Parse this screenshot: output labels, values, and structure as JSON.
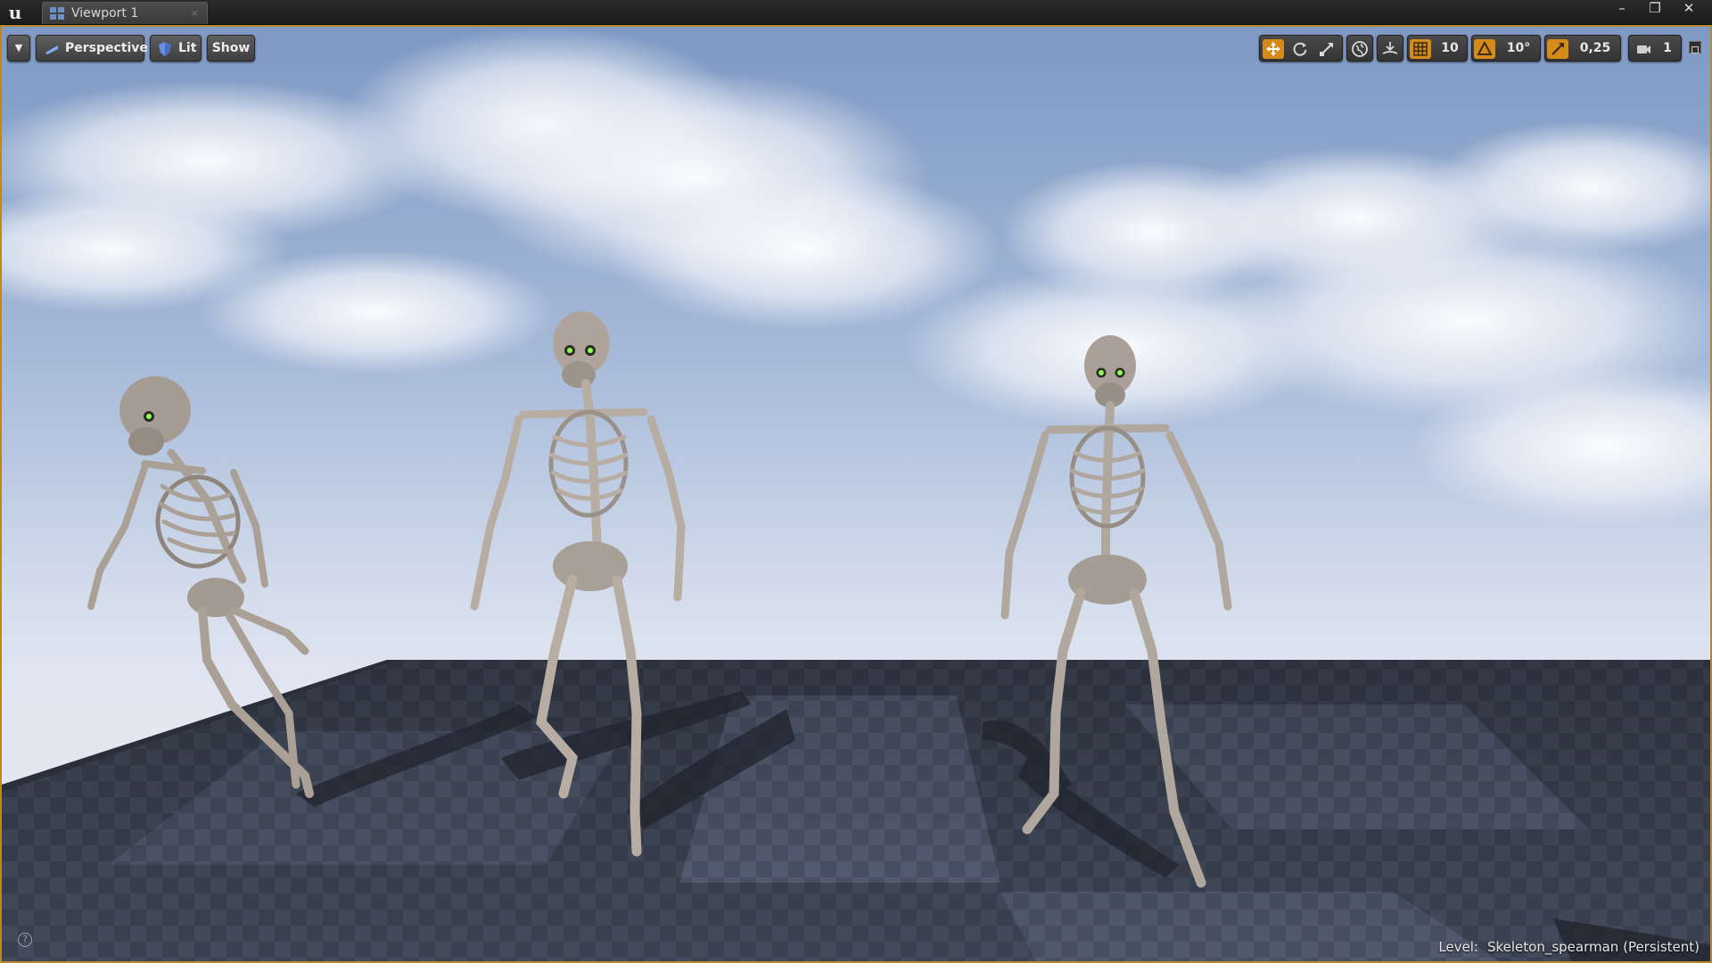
{
  "window": {
    "tab_label": "Viewport 1",
    "tab_close": "×",
    "minimize": "–",
    "restore": "❐",
    "close": "✕"
  },
  "toolbar": {
    "menu_icon": "▼",
    "view_mode": "Perspective",
    "lighting_mode": "Lit",
    "show_label": "Show",
    "grid_snap_value": "10",
    "rotation_snap_value": "10°",
    "scale_snap_value": "0,25",
    "camera_speed_value": "1",
    "icons": [
      "translate-icon",
      "rotate-icon",
      "scale-icon",
      "world-local-icon",
      "surface-snap-icon",
      "grid-snap-icon",
      "rotation-snap-icon",
      "scale-snap-icon",
      "camera-speed-icon",
      "maximize-icon"
    ]
  },
  "status": {
    "level_prefix": "Level:",
    "level_name": "Skeleton_spearman (Persistent)",
    "help_icon": "?"
  },
  "scene": {
    "objects": [
      "skeleton-left",
      "skeleton-center",
      "skeleton-right"
    ],
    "colors": {
      "sky_top": "#7f99c4",
      "sky_horizon": "#e2e7f2",
      "floor_dark": "#2f3542",
      "floor_light": "#56607a",
      "bone": "#bdb2a8",
      "eye_glow": "#8dff57",
      "selection_border": "#b58a2e",
      "active_tool": "#d68a1a"
    }
  }
}
